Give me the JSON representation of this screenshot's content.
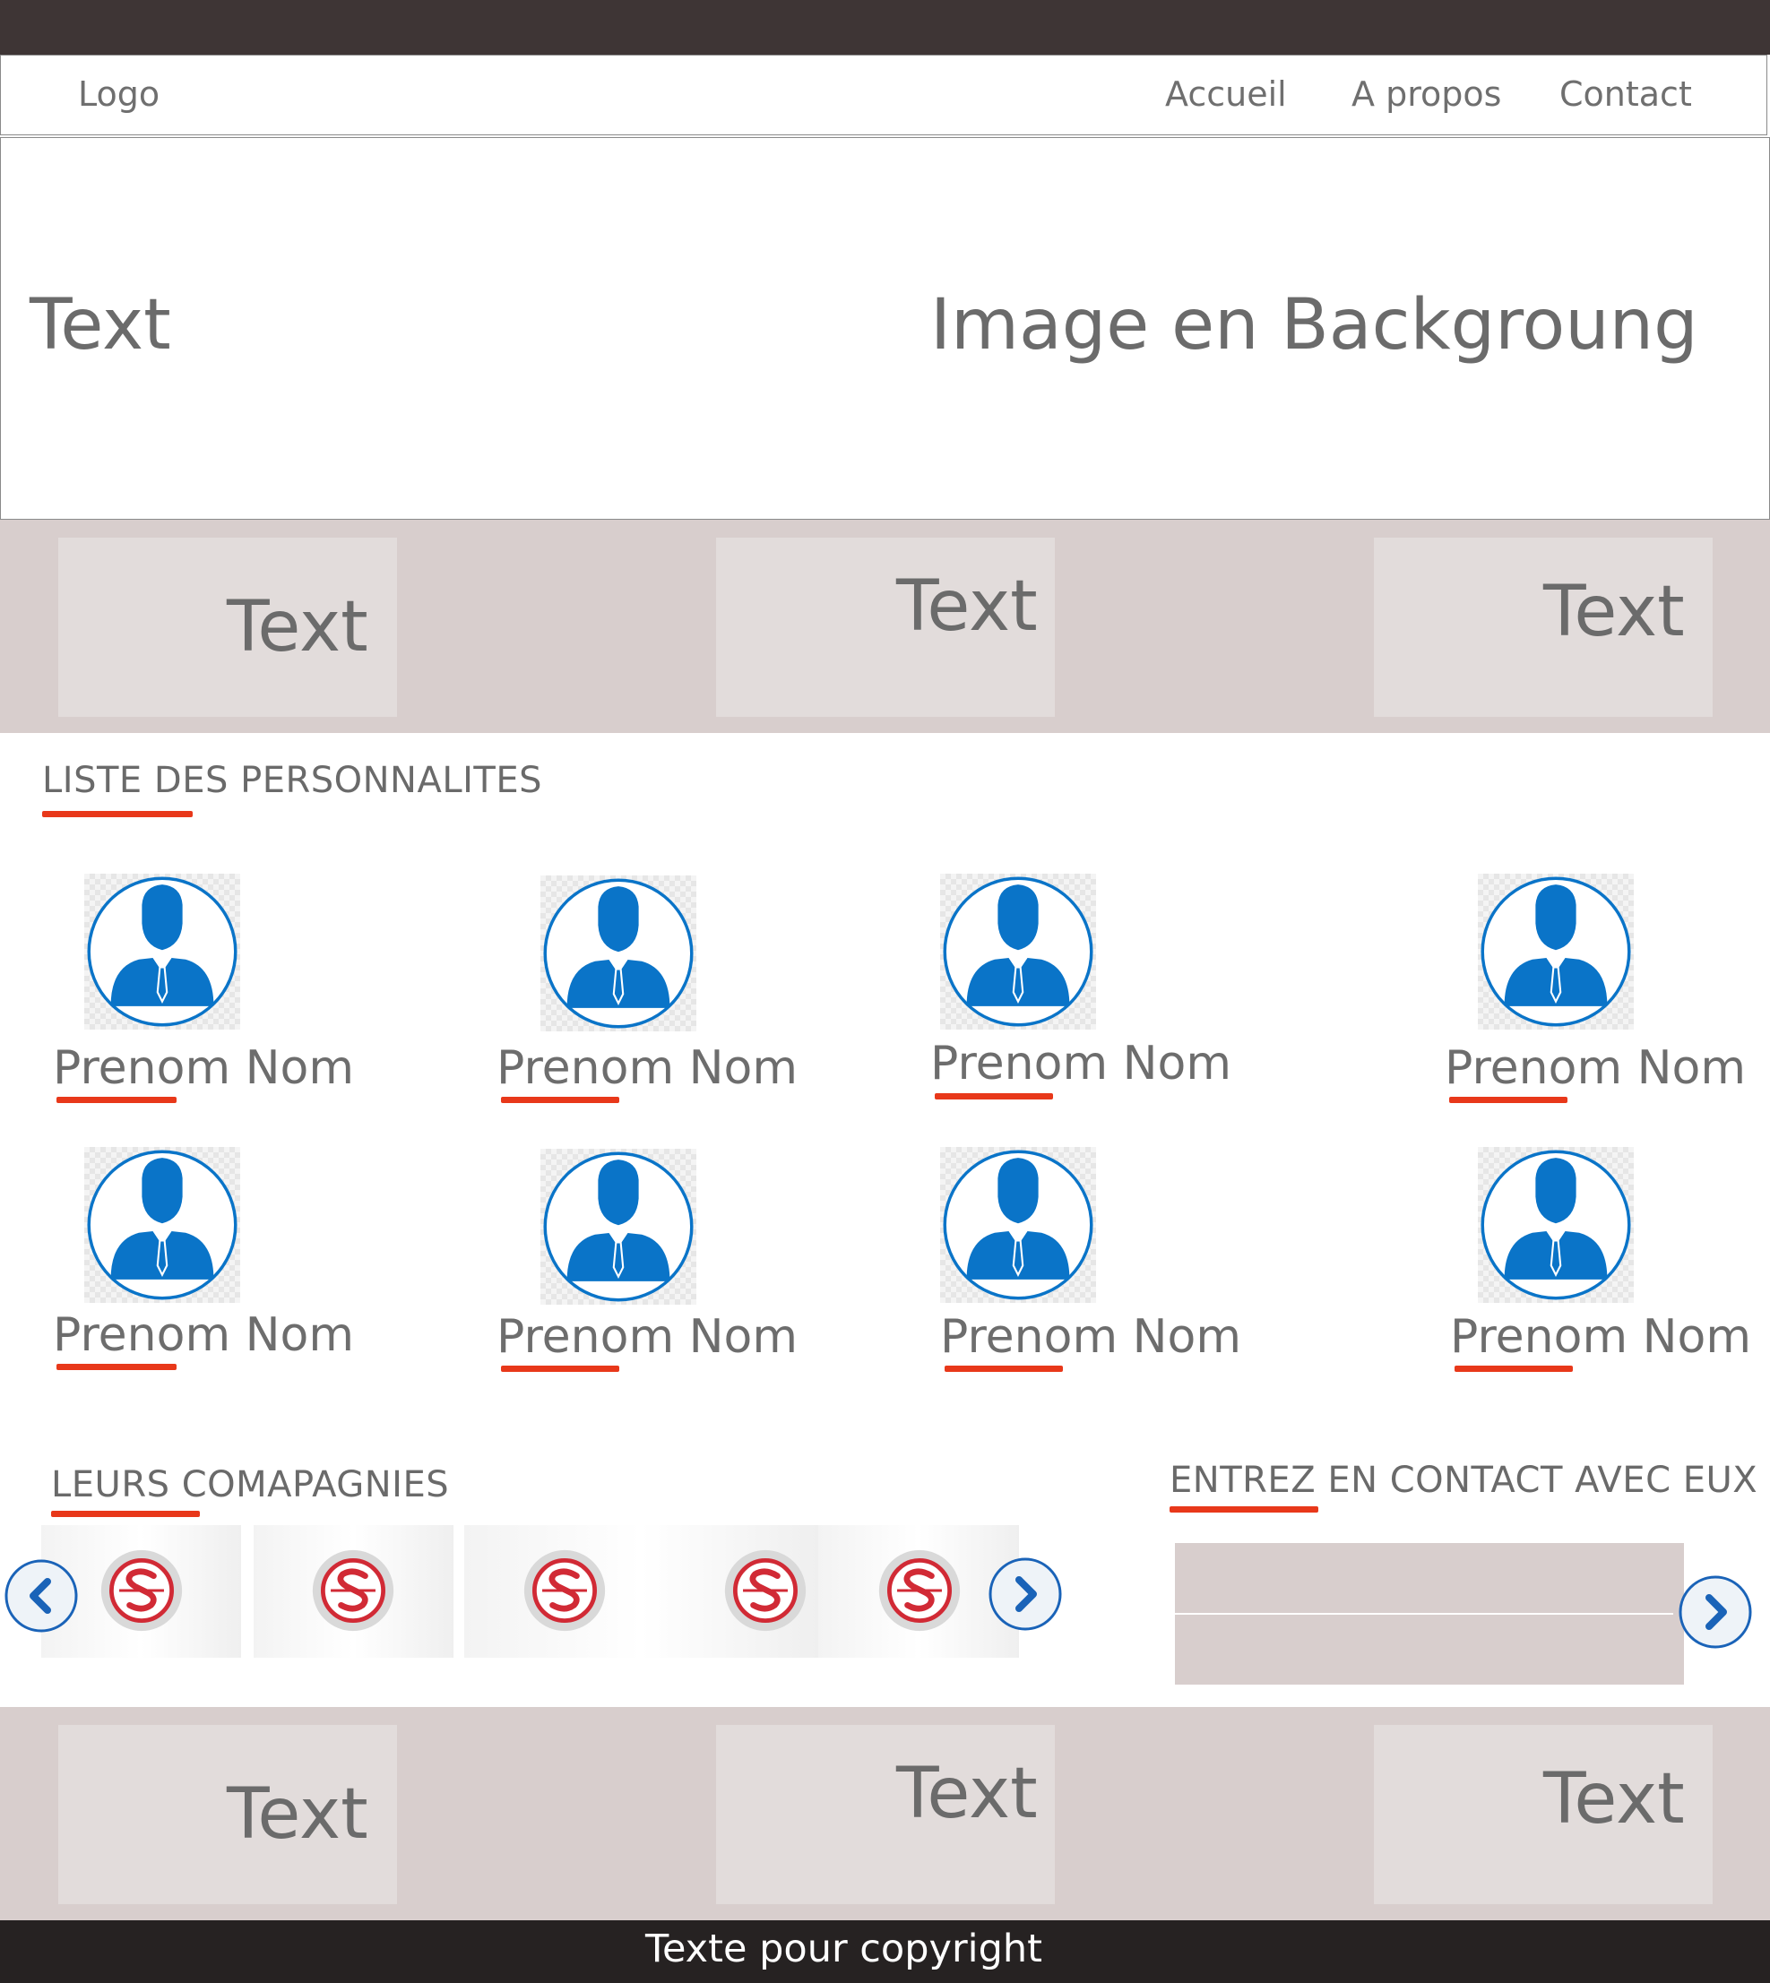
{
  "navbar": {
    "logo": "Logo",
    "links": [
      "Accueil",
      "A propos",
      "Contact"
    ]
  },
  "hero": {
    "text": "Text",
    "background_label": "Image en Backgroung"
  },
  "features_top": [
    "Text",
    "Text",
    "Text"
  ],
  "personalities": {
    "title": "LISTE DES PERSONNALITES",
    "people": [
      "Prenom Nom",
      "Prenom Nom",
      "Prenom Nom",
      "Prenom Nom",
      "Prenom Nom",
      "Prenom Nom",
      "Prenom Nom",
      "Prenom Nom"
    ],
    "avatar_icon": "businessman-avatar-icon",
    "icon_color": "#0a74c8"
  },
  "companies": {
    "title": "LEURS COMAPAGNIES",
    "logo_icon": "company-name-logo",
    "logo_color": "#d12a35",
    "prev_icon": "chevron-left-icon",
    "next_icon": "chevron-right-icon"
  },
  "contact": {
    "title": "ENTREZ EN CONTACT AVEC EUX",
    "next_icon": "chevron-right-icon"
  },
  "features_bottom": [
    "Text",
    "Text",
    "Text"
  ],
  "footer": {
    "copyright": "Texte pour copyright"
  },
  "colors": {
    "accent_underline": "#e8381a",
    "band_bg": "#d8cecd",
    "tile_bg": "#e2dcdb",
    "top_strip": "#3e3535",
    "footer_bg": "#262222"
  }
}
